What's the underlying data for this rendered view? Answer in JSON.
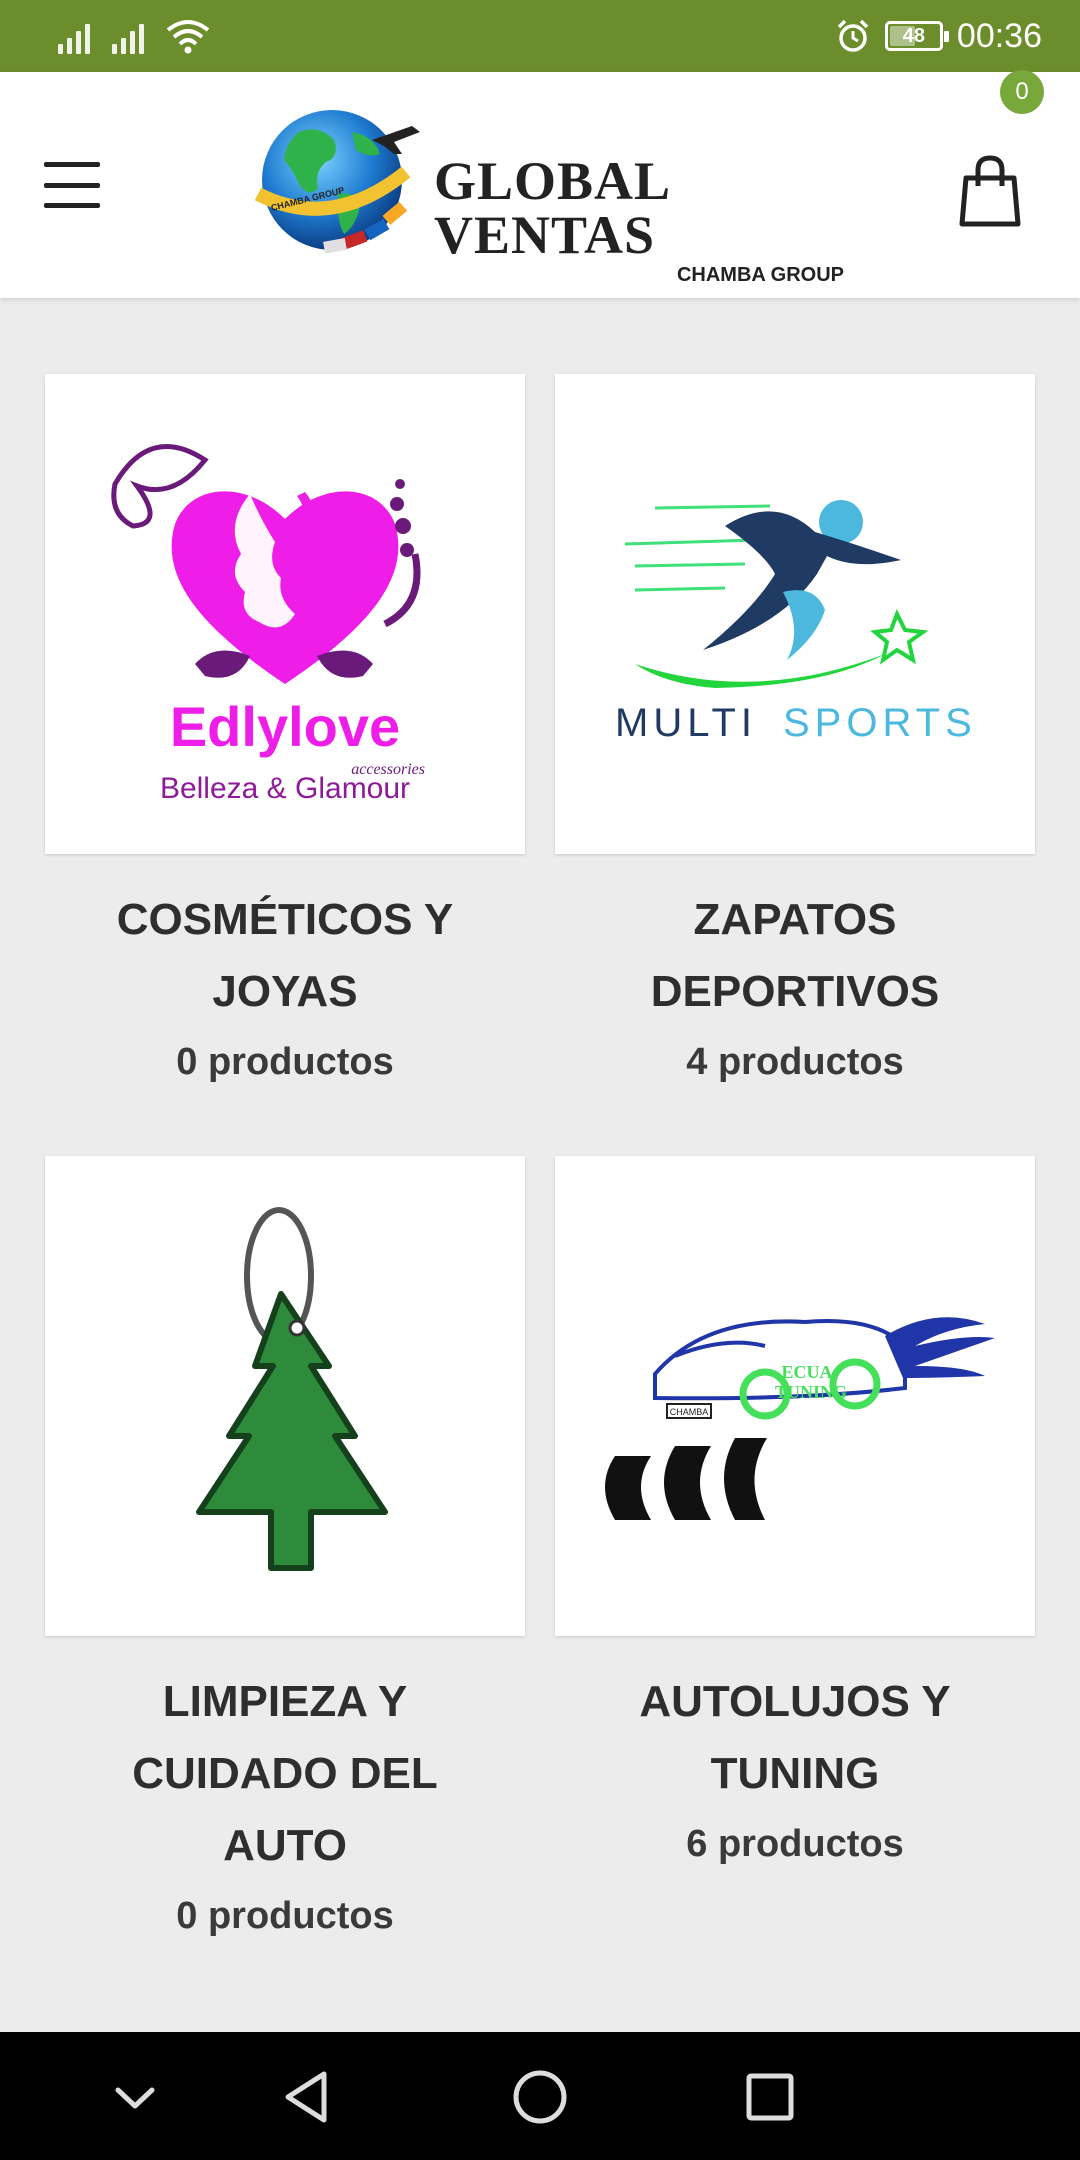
{
  "status_bar": {
    "time": "00:36",
    "battery": "48",
    "icons": [
      "signal-icon",
      "signal-icon",
      "wifi-icon",
      "alarm-icon",
      "battery-icon"
    ]
  },
  "header": {
    "brand_title": "GLOBAL VENTAS",
    "brand_subtitle": "CHAMBA GROUP",
    "globe_ribbon": "CHAMBA GROUP",
    "cart_count": "0"
  },
  "categories": [
    {
      "title_line1": "COSMÉTICOS Y",
      "title_line2": "JOYAS",
      "count": "0 productos",
      "logo_name": "Edlylove",
      "logo_tag": "accessories",
      "logo_sub": "Belleza & Glamour"
    },
    {
      "title_line1": "ZAPATOS",
      "title_line2": "DEPORTIVOS",
      "count": "4 productos",
      "logo_word1": "MULTI",
      "logo_word2": "SPORTS"
    },
    {
      "title_line1": "LIMPIEZA Y",
      "title_line2": "CUIDADO DEL",
      "title_line3": "AUTO",
      "count": "0 productos"
    },
    {
      "title_line1": "AUTOLUJOS Y",
      "title_line2": "TUNING",
      "count": "6 productos",
      "logo_line1": "ECUA",
      "logo_line2": "TUNING",
      "plate": "CHAMBA"
    }
  ],
  "colors": {
    "status_bar": "#6c8d2b",
    "accent": "#79a83a",
    "text": "#2e2e2e",
    "background": "#ececec"
  }
}
